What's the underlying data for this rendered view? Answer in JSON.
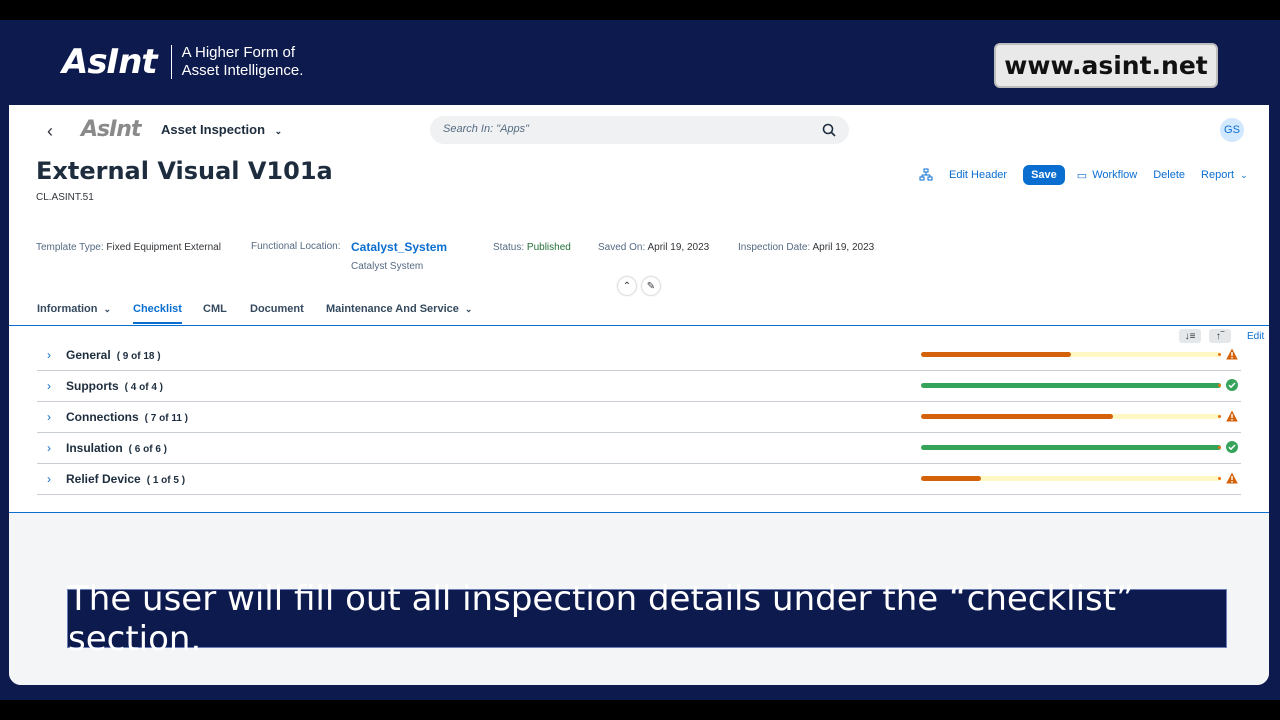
{
  "brand": {
    "logo": "AsInt",
    "tagline_line1": "A Higher Form of",
    "tagline_line2": "Asset Intelligence."
  },
  "site_url": "www.asint.net",
  "shell": {
    "logo": "AsInt",
    "app_name": "Asset Inspection",
    "search_placeholder": "Search In: \"Apps\"",
    "avatar": "GS"
  },
  "header": {
    "title": "External Visual V101a",
    "subtitle": "CL.ASINT.51",
    "actions": {
      "edit_header": "Edit Header",
      "save": "Save",
      "workflow": "Workflow",
      "delete": "Delete",
      "report": "Report"
    }
  },
  "meta": {
    "template_type_label": "Template Type:",
    "template_type": "Fixed Equipment External",
    "functional_location_label": "Functional Location:",
    "functional_location": "Catalyst_System",
    "functional_location_desc": "Catalyst System",
    "status_label": "Status:",
    "status": "Published",
    "saved_on_label": "Saved On:",
    "saved_on": "April 19, 2023",
    "inspection_date_label": "Inspection Date:",
    "inspection_date": "April 19, 2023"
  },
  "tabs": [
    {
      "label": "Information"
    },
    {
      "label": "Checklist"
    },
    {
      "label": "CML"
    },
    {
      "label": "Document"
    },
    {
      "label": "Maintenance And Service"
    }
  ],
  "tools": {
    "edit": "Edit"
  },
  "checklist": [
    {
      "name": "General",
      "count": "( 9 of 18 )",
      "progress": 0.5,
      "complete": false
    },
    {
      "name": "Supports",
      "count": "( 4 of 4 )",
      "progress": 1.0,
      "complete": true
    },
    {
      "name": "Connections",
      "count": "( 7 of 11 )",
      "progress": 0.64,
      "complete": false
    },
    {
      "name": "Insulation",
      "count": "( 6 of 6 )",
      "progress": 1.0,
      "complete": true
    },
    {
      "name": "Relief Device",
      "count": "( 1 of 5 )",
      "progress": 0.2,
      "complete": false
    }
  ],
  "colors": {
    "incomplete": "#d4620a",
    "complete": "#36a35a",
    "track": "#fff7c4"
  },
  "caption": "The user will fill out all inspection details under the “checklist” section."
}
